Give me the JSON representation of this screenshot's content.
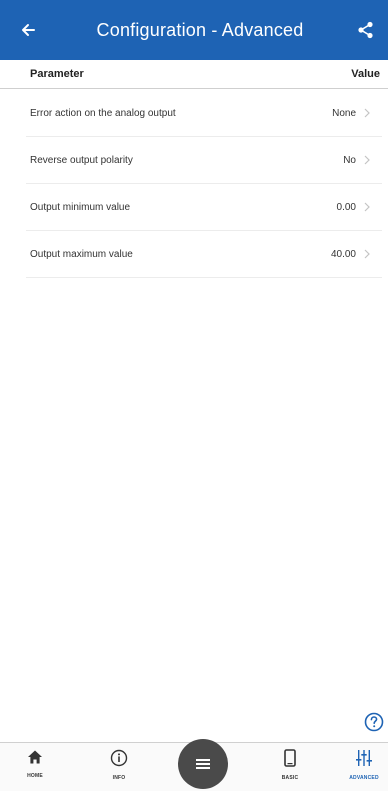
{
  "header": {
    "title": "Configuration - Advanced"
  },
  "table": {
    "col_parameter": "Parameter",
    "col_value": "Value",
    "rows": [
      {
        "label": "Error action on the analog output",
        "value": "None"
      },
      {
        "label": "Reverse output polarity",
        "value": "No"
      },
      {
        "label": "Output minimum value",
        "value": "0.00"
      },
      {
        "label": "Output maximum value",
        "value": "40.00"
      }
    ]
  },
  "bottom_nav": {
    "home": "HOME",
    "info": "INFO",
    "basic": "BASIC",
    "advanced": "ADVANCED"
  },
  "colors": {
    "header_bg": "#1e63b4",
    "accent": "#1e63b4",
    "fab": "#4a4a4a"
  }
}
